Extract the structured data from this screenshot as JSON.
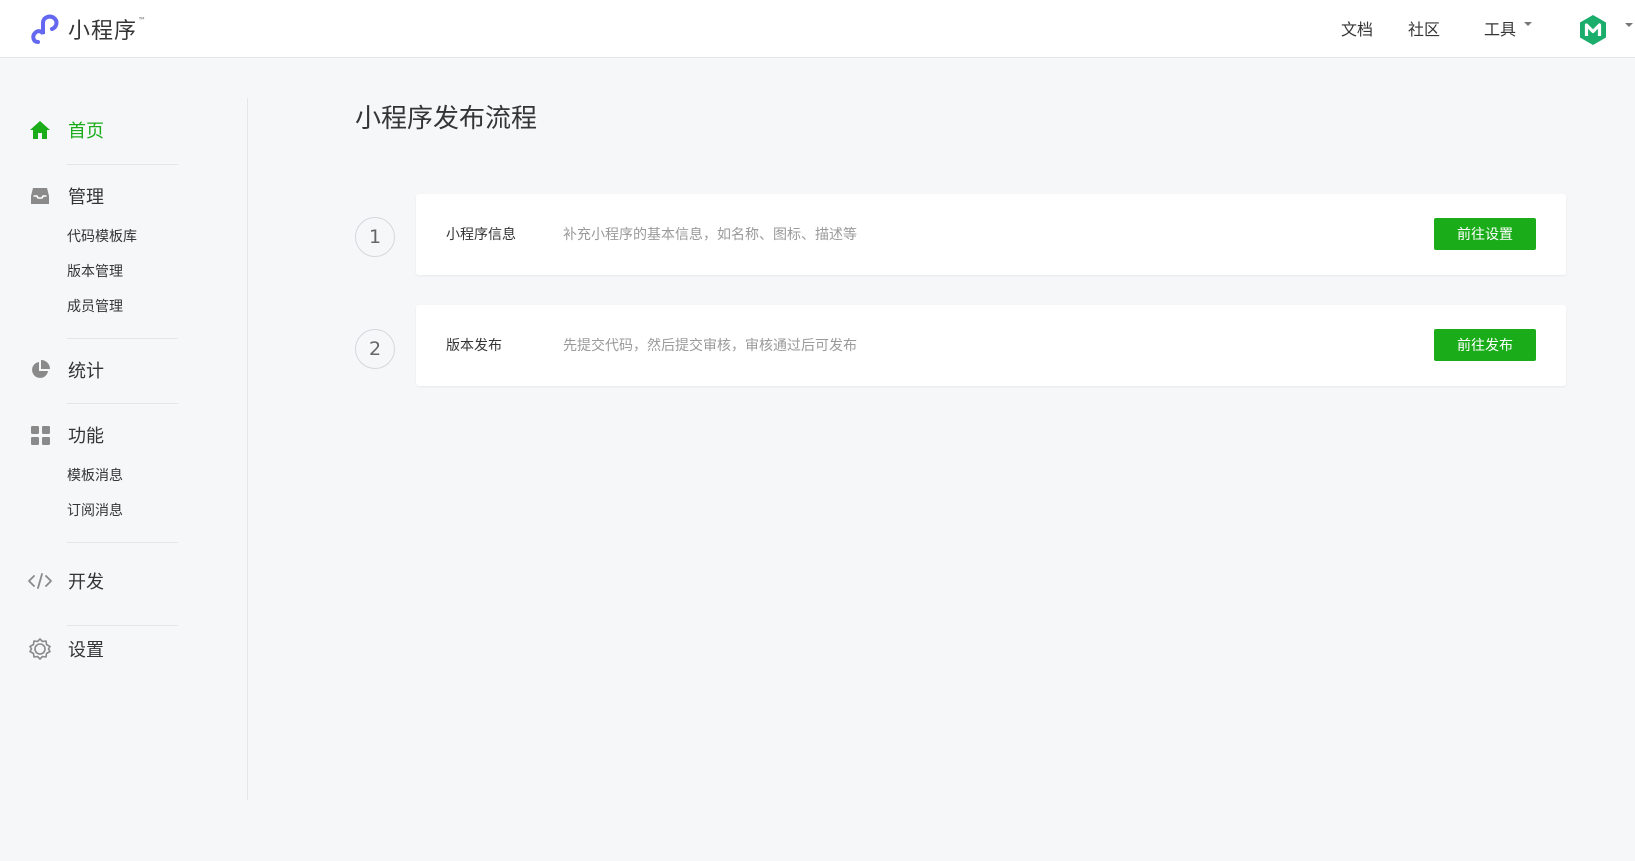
{
  "header": {
    "brand_name": "小程序",
    "brand_tm": "™",
    "nav": [
      {
        "label": "文档"
      },
      {
        "label": "社区"
      },
      {
        "label": "工具"
      }
    ]
  },
  "sidebar": {
    "groups": [
      {
        "label": "首页",
        "icon": "home-icon",
        "active": true,
        "items": []
      },
      {
        "label": "管理",
        "icon": "inbox-icon",
        "items": [
          {
            "label": "代码模板库"
          },
          {
            "label": "版本管理"
          },
          {
            "label": "成员管理"
          }
        ]
      },
      {
        "label": "统计",
        "icon": "pie-chart-icon",
        "items": []
      },
      {
        "label": "功能",
        "icon": "grid-icon",
        "items": [
          {
            "label": "模板消息"
          },
          {
            "label": "订阅消息"
          }
        ]
      },
      {
        "label": "开发",
        "icon": "code-icon",
        "items": []
      },
      {
        "label": "设置",
        "icon": "gear-icon",
        "items": []
      }
    ]
  },
  "main": {
    "title": "小程序发布流程",
    "steps": [
      {
        "number": "1",
        "title": "小程序信息",
        "description": "补充小程序的基本信息，如名称、图标、描述等",
        "button": "前往设置"
      },
      {
        "number": "2",
        "title": "版本发布",
        "description": "先提交代码，然后提交审核，审核通过后可发布",
        "button": "前往发布"
      }
    ]
  },
  "colors": {
    "accent": "#1aad19",
    "brand_logo": "#6467f0",
    "avatar": "#1aad6b"
  }
}
